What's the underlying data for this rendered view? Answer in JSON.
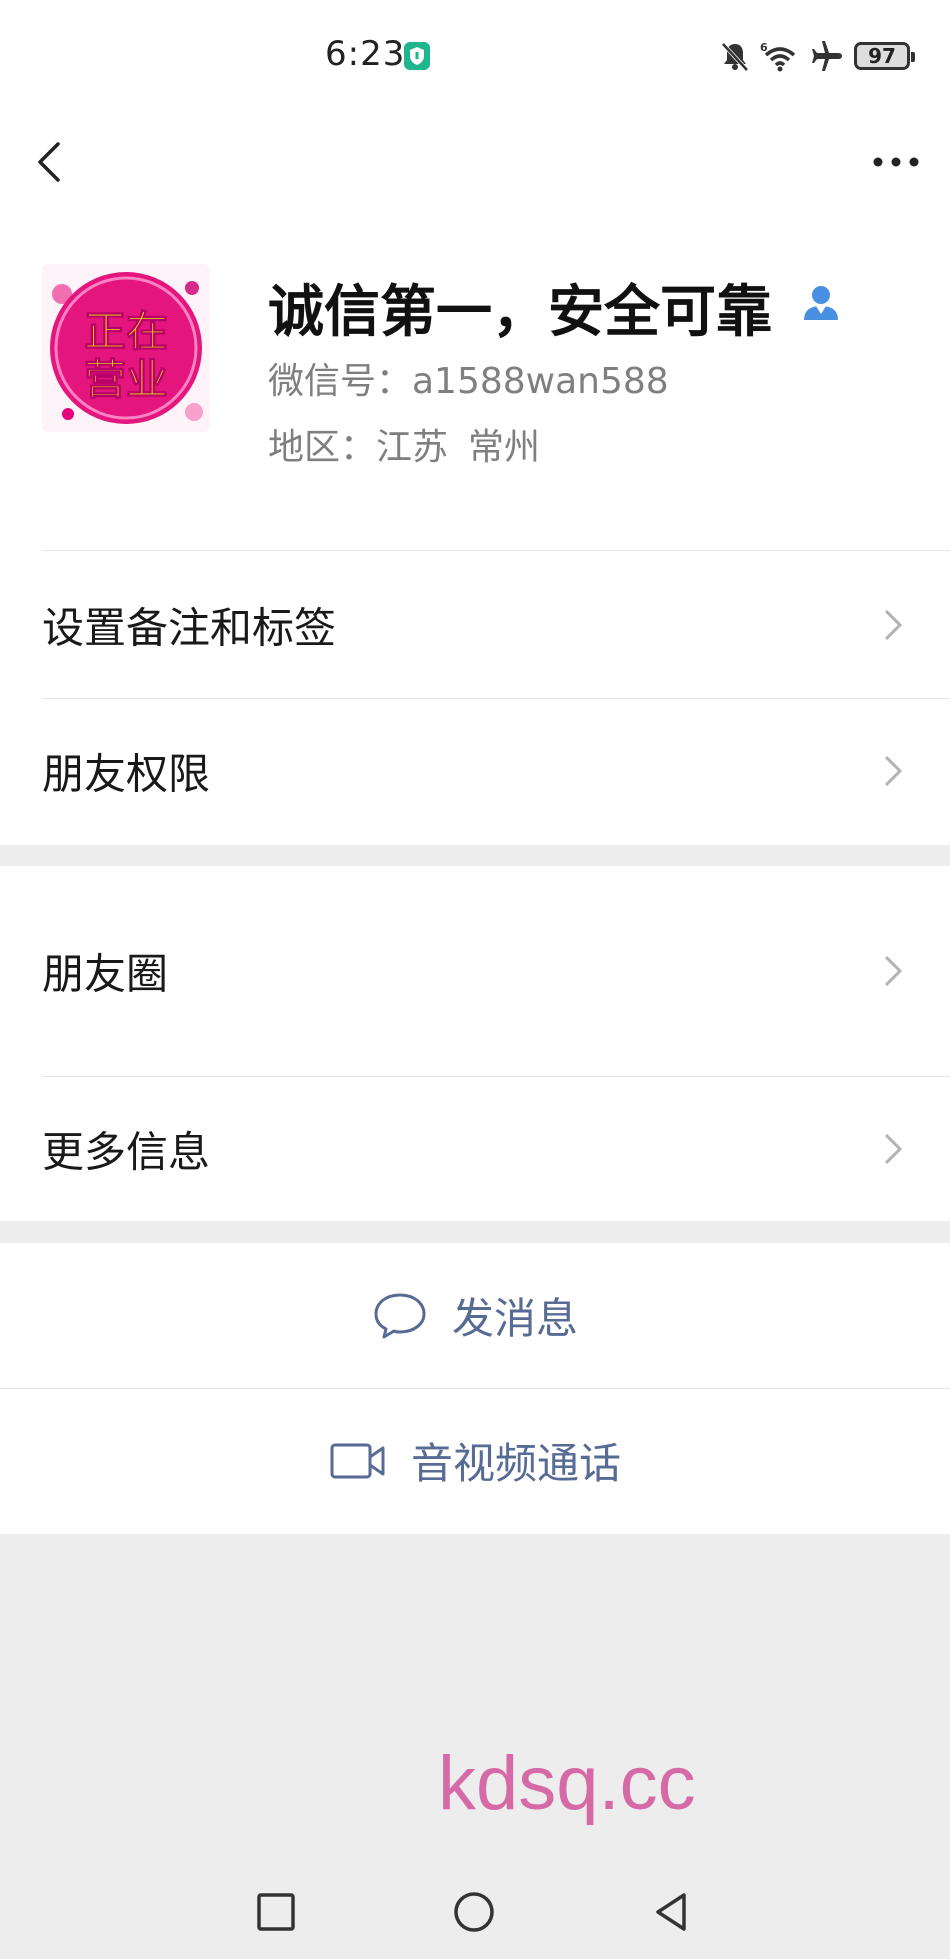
{
  "status_bar": {
    "time": "6:23",
    "battery": "97",
    "icons": [
      "shield-icon",
      "mute-icon",
      "wifi-6-icon",
      "airplane-icon",
      "battery-icon"
    ]
  },
  "nav": {
    "icons": [
      "back-icon",
      "more-icon"
    ]
  },
  "profile": {
    "name": "诚信第一，安全可靠",
    "wechat_id": "微信号：a1588wan588",
    "region_label": "地区：",
    "region_province": "江苏",
    "region_city": "常州",
    "avatar_line1": "正在",
    "avatar_line2": "营业"
  },
  "menu_group_1": [
    {
      "label": "设置备注和标签"
    },
    {
      "label": "朋友权限"
    }
  ],
  "menu_group_2": [
    {
      "label": "朋友圈"
    },
    {
      "label": "更多信息"
    }
  ],
  "actions": {
    "message": "发消息",
    "call": "音视频通话"
  },
  "watermark": "kdsq.cc",
  "colors": {
    "link": "#576b95",
    "background": "#ededed",
    "card": "#ffffff",
    "avatar_magenta": "#e4157c",
    "avatar_yellow": "#f5e400",
    "watermark": "#d66aa6"
  },
  "system_nav": [
    "recent-apps-icon",
    "home-icon",
    "back-triangle-icon"
  ]
}
